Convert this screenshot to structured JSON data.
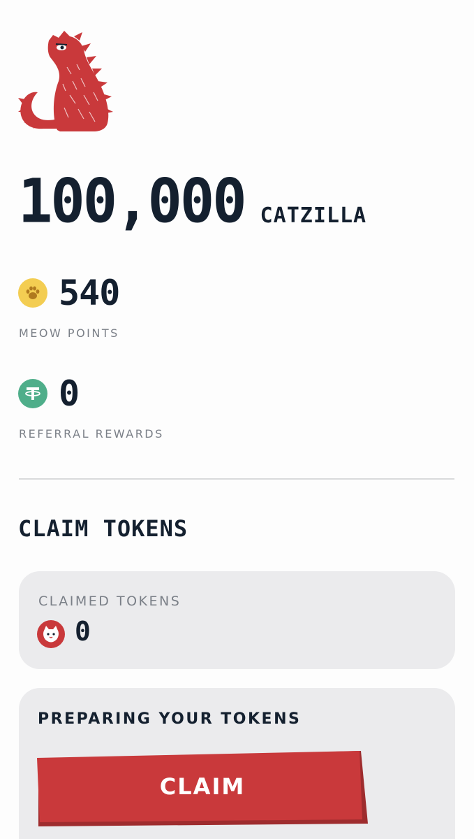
{
  "brand": {
    "logo_icon": "red-cat-monster-icon",
    "accent_color": "#c9393b",
    "text_color": "#14202f"
  },
  "balance": {
    "amount": "100,000",
    "unit": "CATZILLA"
  },
  "meow_points": {
    "icon": "paw-coin-icon",
    "value": "540",
    "label": "MEOW POINTS"
  },
  "referral_rewards": {
    "icon": "tether-coin-icon",
    "value": "0",
    "label": "REFERRAL REWARDS"
  },
  "claim_section": {
    "title": "CLAIM TOKENS",
    "claimed": {
      "label": "CLAIMED TOKENS",
      "icon": "cat-face-coin-icon",
      "value": "0"
    },
    "prepare": {
      "title": "PREPARING YOUR TOKENS",
      "button_label": "CLAIM"
    }
  }
}
